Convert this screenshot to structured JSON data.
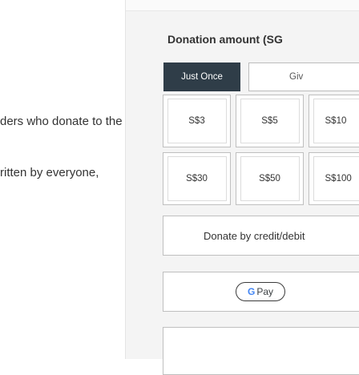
{
  "page": {
    "line1": "ders who donate to the",
    "line2": "ritten by everyone,"
  },
  "widget": {
    "heading": "Donation amount (SG",
    "frequency": {
      "once_label": "Just Once",
      "other_label": "Giv"
    },
    "amounts": [
      {
        "label": "S$3"
      },
      {
        "label": "S$5"
      },
      {
        "label": "S$10"
      },
      {
        "label": "S$30"
      },
      {
        "label": "S$50"
      },
      {
        "label": "S$100"
      }
    ],
    "card_button_label": "Donate by credit/debit",
    "gpay_button_label": "Pay",
    "gpay_g": "G"
  },
  "colors": {
    "dark_button": "#2f3d48",
    "widget_bg": "#f4f4f4"
  }
}
